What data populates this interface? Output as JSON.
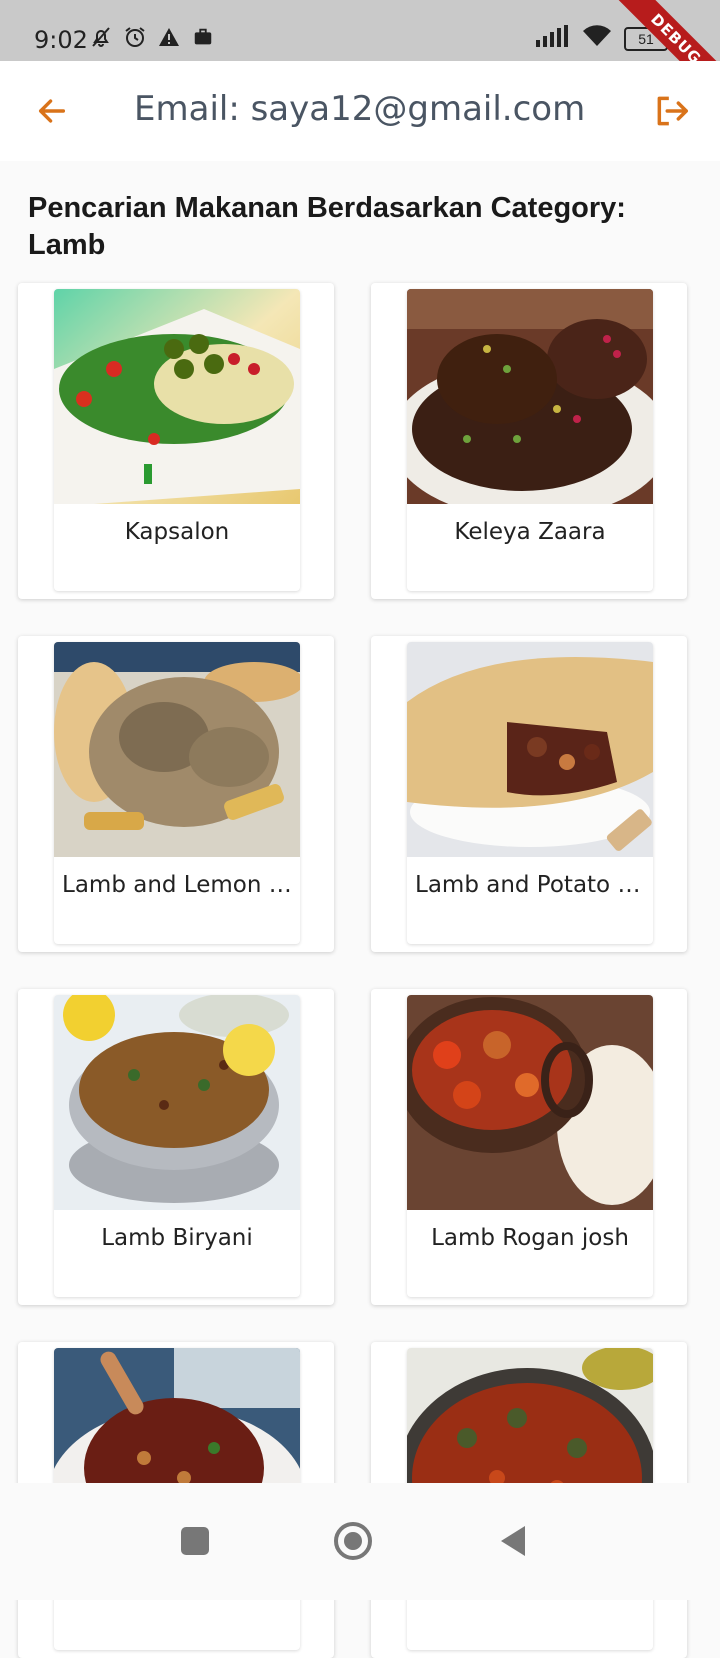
{
  "status_bar": {
    "time": "9:02",
    "battery": "51"
  },
  "debug_label": "DEBUG",
  "app_bar": {
    "title": "Email: saya12@gmail.com"
  },
  "heading": "Pencarian Makanan Berdasarkan Category: Lamb",
  "meals": [
    {
      "name": "Kapsalon"
    },
    {
      "name": "Keleya Zaara"
    },
    {
      "name": "Lamb and Lemon Souvlaki"
    },
    {
      "name": "Lamb and Potato pie"
    },
    {
      "name": "Lamb Biryani"
    },
    {
      "name": "Lamb Rogan josh"
    },
    {
      "name": ""
    },
    {
      "name": ""
    }
  ],
  "icons": {
    "back": "arrow-left-icon",
    "logout": "logout-icon",
    "nav_recent": "square-icon",
    "nav_home": "circle-icon",
    "nav_back": "triangle-back-icon"
  },
  "colors": {
    "accent": "#d9731a",
    "status_bar_bg": "#c9c9c9",
    "ribbon": "#b71c1c"
  }
}
